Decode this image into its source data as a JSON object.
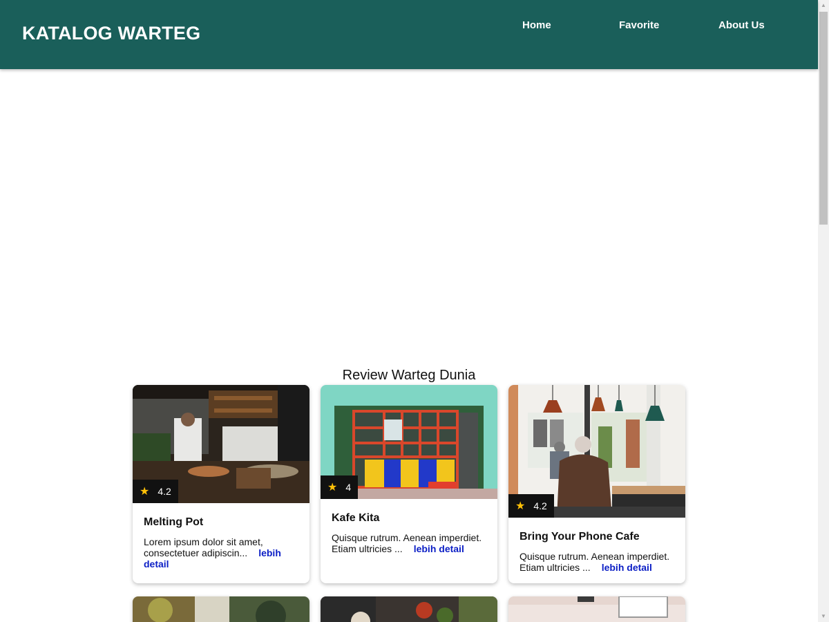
{
  "header": {
    "brand": "KATALOG WARTEG",
    "nav": [
      "Home",
      "Favorite",
      "About Us"
    ],
    "background_color": "#1a5f5a"
  },
  "main": {
    "section_title": "Review Warteg Dunia",
    "restaurants": [
      {
        "name": "Melting Pot",
        "rating": "4.2",
        "description": "Lorem ipsum dolor sit amet, consectetuer adipiscin...",
        "link_label": "lebih detail"
      },
      {
        "name": "Kafe Kita",
        "rating": "4",
        "description": "Quisque rutrum. Aenean imperdiet. Etiam ultricies ...",
        "link_label": "lebih detail"
      },
      {
        "name": "Bring Your Phone Cafe",
        "rating": "4.2",
        "description": "Quisque rutrum. Aenean imperdiet. Etiam ultricies ...",
        "link_label": "lebih detail"
      }
    ]
  },
  "colors": {
    "star": "#ffc107",
    "link": "#0b1ec5",
    "rating_badge": "#111111"
  }
}
